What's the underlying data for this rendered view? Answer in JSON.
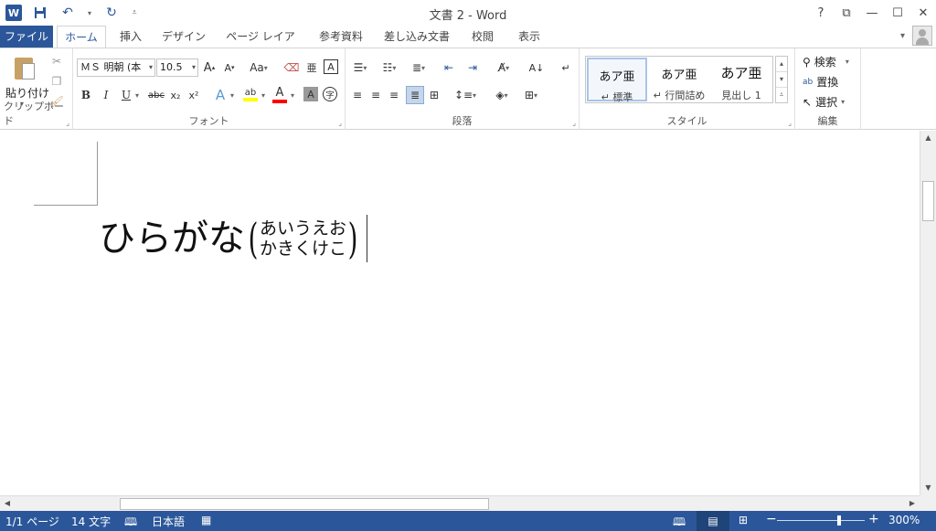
{
  "window": {
    "title": "文書 2 - Word",
    "help": "?",
    "logo": "W"
  },
  "tabs": [
    "ファイル",
    "ホーム",
    "挿入",
    "デザイン",
    "ページ レイアウト",
    "参考資料",
    "差し込み文書",
    "校閲",
    "表示"
  ],
  "ribbon": {
    "clipboard": {
      "label": "クリップボード",
      "paste": "貼り付け"
    },
    "font": {
      "label": "フォント",
      "name": "ＭＳ 明朝 (本",
      "size": "10.5",
      "grow": "A",
      "shrink": "A",
      "case": "Aa",
      "phonetic": "亜",
      "border_char": "A",
      "bold": "B",
      "italic": "I",
      "underline": "U",
      "strike": "abc",
      "sub": "x₂",
      "sup": "x²",
      "effects": "A",
      "highlight": "ab",
      "color": "A",
      "shade": "A",
      "enclose": "字"
    },
    "paragraph": {
      "label": "段落"
    },
    "styles": {
      "label": "スタイル",
      "items": [
        {
          "sample": "あア亜",
          "name": "↵ 標準"
        },
        {
          "sample": "あア亜",
          "name": "↵ 行間詰め"
        },
        {
          "sample": "あア亜",
          "name": "見出し 1"
        }
      ]
    },
    "editing": {
      "label": "編集",
      "find": "検索",
      "replace": "置換",
      "select": "選択"
    }
  },
  "document": {
    "base_text": "ひらがな",
    "open_paren": "(",
    "close_paren": ")",
    "warichu_line1": "あいうえお",
    "warichu_line2": "かきくけこ"
  },
  "status": {
    "page": "1/1 ページ",
    "words": "14 文字",
    "language": "日本語",
    "zoom": "300%",
    "zoom_minus": "−",
    "zoom_plus": "+"
  },
  "colors": {
    "accent": "#2b579a",
    "highlight": "#ffff00",
    "font_color": "#ff0000"
  }
}
